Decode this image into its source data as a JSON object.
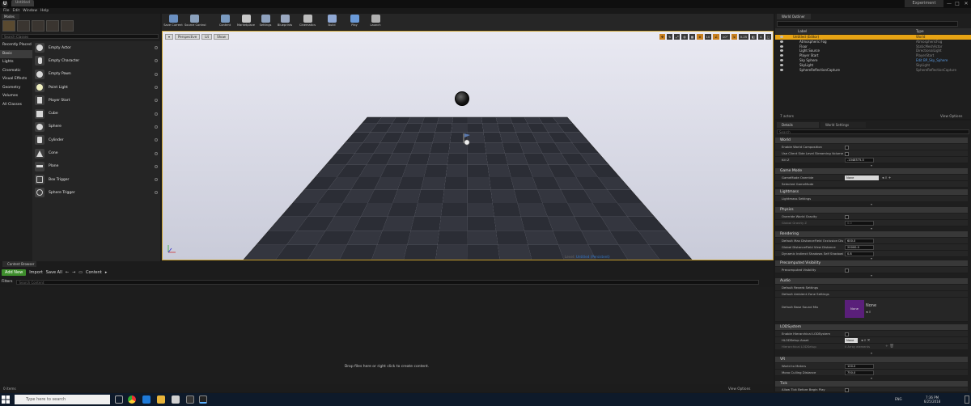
{
  "window": {
    "logo": "U",
    "tab": "Untitled",
    "project": "Experiment",
    "min": "—",
    "max": "□",
    "close": "✕"
  },
  "menu": [
    "File",
    "Edit",
    "Window",
    "Help"
  ],
  "modes": {
    "tab": "Modes",
    "search_placeholder": "Search Classes",
    "categories": [
      "Recently Placed",
      "Basic",
      "Lights",
      "Cinematic",
      "Visual Effects",
      "Geometry",
      "Volumes",
      "All Classes"
    ],
    "active_category": "Basic",
    "actors": [
      "Empty Actor",
      "Empty Character",
      "Empty Pawn",
      "Point Light",
      "Player Start",
      "Cube",
      "Sphere",
      "Cylinder",
      "Cone",
      "Plane",
      "Box Trigger",
      "Sphere Trigger"
    ]
  },
  "toolbar": [
    {
      "label": "Save Current",
      "icon": "save-icon",
      "color": "#6a8fc0"
    },
    {
      "label": "Source Control",
      "icon": "source-control-icon",
      "color": "#8aa0bc"
    },
    {
      "label": "Content",
      "icon": "content-icon",
      "color": "#7a9ac0"
    },
    {
      "label": "Marketplace",
      "icon": "marketplace-icon",
      "color": "#c8c8c8"
    },
    {
      "label": "Settings",
      "icon": "settings-icon",
      "color": "#8fa2be"
    },
    {
      "label": "Blueprints",
      "icon": "blueprints-icon",
      "color": "#9aa8c0"
    },
    {
      "label": "Cinematics",
      "icon": "cinematics-icon",
      "color": "#bcbcbc"
    },
    {
      "label": "Build",
      "icon": "build-icon",
      "color": "#8fa8d4"
    },
    {
      "label": "Play",
      "icon": "play-icon",
      "color": "#6a9ad8"
    },
    {
      "label": "Launch",
      "icon": "launch-icon",
      "color": "#b0b0b0"
    }
  ],
  "viewport": {
    "perspective": "Perspective",
    "lit": "Lit",
    "show": "Show",
    "right_controls": [
      "10",
      "10°",
      "0.25",
      "4"
    ],
    "level_prefix": "Level:",
    "level_name": "Untitled (Persistent)"
  },
  "content_browser": {
    "tab": "Content Browser",
    "add_new": "Add New",
    "import": "Import",
    "save_all": "Save All",
    "path": "Content",
    "filters": "Filters",
    "search_placeholder": "Search Content",
    "drop_message": "Drop files here or right click to create content.",
    "item_count": "0 items",
    "view_options": "View Options"
  },
  "outliner": {
    "tab": "World Outliner",
    "col_label": "Label",
    "col_type": "Type",
    "rows": [
      {
        "name": "Untitled (Editor)",
        "type": "World"
      },
      {
        "name": "Atmospheric Fog",
        "type": "AtmosphericFog"
      },
      {
        "name": "Floor",
        "type": "StaticMeshActor"
      },
      {
        "name": "Light Source",
        "type": "DirectionalLight"
      },
      {
        "name": "Player Start",
        "type": "PlayerStart"
      },
      {
        "name": "Sky Sphere",
        "type": "Edit BP_Sky_Sphere"
      },
      {
        "name": "SkyLight",
        "type": "SkyLight"
      },
      {
        "name": "SphereReflectionCapture",
        "type": "SphereReflectionCapture"
      }
    ],
    "count": "7 actors",
    "view_options": "View Options"
  },
  "details": {
    "tab_details": "Details",
    "tab_world": "World Settings",
    "search_placeholder": "Search",
    "sections": {
      "world": "World",
      "game_mode": "Game Mode",
      "lightmass": "Lightmass",
      "physics": "Physics",
      "rendering": "Rendering",
      "precomputed": "Precomputed Visibility",
      "audio": "Audio",
      "lod": "LODSystem",
      "vr": "VR",
      "tick": "Tick"
    },
    "props": {
      "enable_world_comp": "Enable World Composition",
      "use_client_side": "Use Client Side Level Streaming Volumes",
      "kill_z": "Kill Z",
      "kill_z_val": "-1048575.0",
      "gamemode_override": "GameMode Override",
      "gamemode_val": "None",
      "selected_gamemode": "Selected GameMode",
      "lightmass_settings": "Lightmass Settings",
      "override_gravity": "Override World Gravity",
      "global_gravity": "Global Gravity Z",
      "global_gravity_val": "0.0",
      "max_sdf": "Default Max DistanceField Occlusion Distance",
      "max_sdf_val": "600.0",
      "global_sdf": "Global DistanceField View Distance",
      "global_sdf_val": "20000.0",
      "dyn_shadow": "Dynamic Indirect Shadows Self Shadowing",
      "dyn_shadow_val": "0.8",
      "precomputed_vis": "Precomputed Visibility",
      "default_reverb": "Default Reverb Settings",
      "default_ambient": "Default Ambient Zone Settings",
      "base_sound_mix": "Default Base Sound Mix",
      "sound_mix_val": "None",
      "sound_mix_thumb": "None",
      "enable_hlod": "Enable Hierarchical LODSystem",
      "hlod_asset": "HLODSetup Asset",
      "hlod_val": "None",
      "hlod_setup": "Hierarchical LODSetup",
      "hlod_elements": "0 Array elements",
      "world_to_meters": "World to Meters",
      "world_to_meters_val": "100.0",
      "mono_cull": "Mono Culling Distance",
      "mono_cull_val": "750.0",
      "allow_tick": "Allow Tick Before Begin Play"
    }
  },
  "taskbar": {
    "search": "Type here to search",
    "time": "7:36 PM",
    "date": "6/25/2018",
    "lang": "ENG"
  }
}
